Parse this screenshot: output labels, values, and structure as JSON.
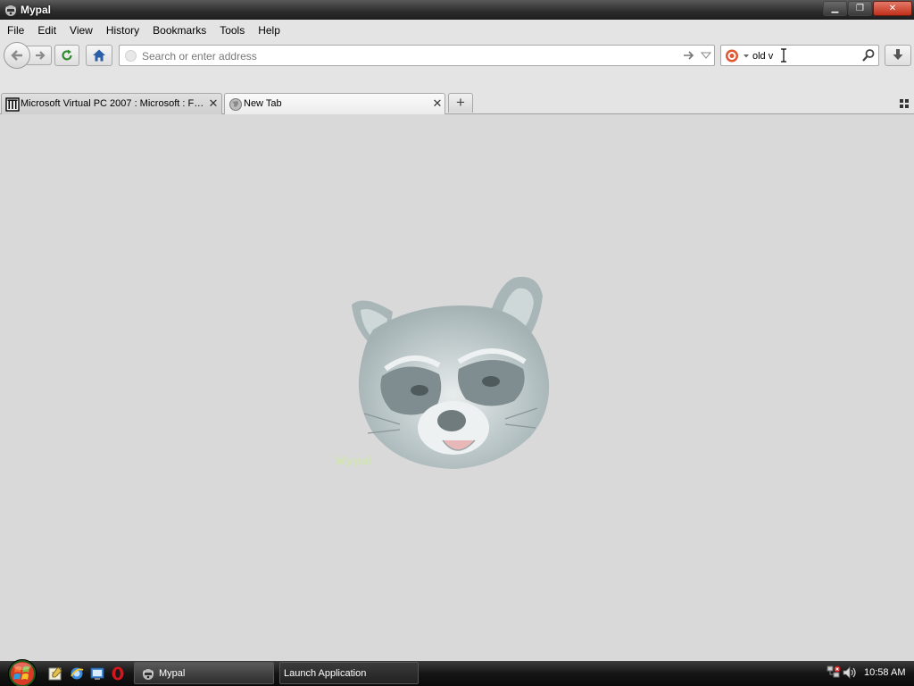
{
  "window": {
    "title": "Mypal",
    "controls": {
      "minimize": "▁",
      "restore": "❐",
      "close": "✕"
    }
  },
  "menu": [
    "File",
    "Edit",
    "View",
    "History",
    "Bookmarks",
    "Tools",
    "Help"
  ],
  "toolbar": {
    "url_placeholder": "Search or enter address",
    "url_value": "",
    "search_value": "old v",
    "icons": [
      "back-icon",
      "forward-icon",
      "reload-icon",
      "home-icon",
      "go-arrow-icon",
      "dropmarker-icon",
      "search-engine-icon",
      "magnifier-icon",
      "download-icon"
    ]
  },
  "tabs": [
    {
      "label": "Microsoft Virtual PC 2007 : Microsoft : Fr...",
      "icon": "archive-icon",
      "selected": false
    },
    {
      "label": "New Tab",
      "icon": "globe-icon",
      "selected": true
    }
  ],
  "new_tab_symbol": "+",
  "close_symbol": "✕",
  "content": {
    "image": "raccoon-logo",
    "brand_text": "Mypal"
  },
  "taskbar": {
    "tasks": [
      {
        "label": "Mypal",
        "active": true
      },
      {
        "label": "Launch Application",
        "active": false
      }
    ],
    "clock": "10:58 AM"
  },
  "colors": {
    "accent": "#2a6cc4",
    "content_bg": "#d9d9d9",
    "chrome_bg": "#e4e4e4"
  }
}
